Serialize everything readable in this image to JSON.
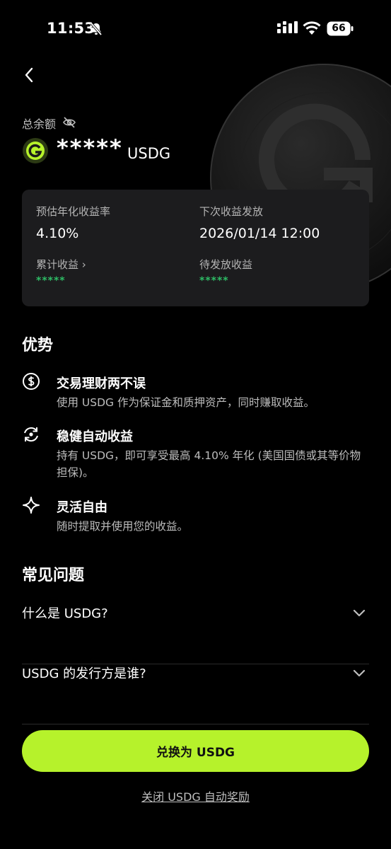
{
  "status_bar": {
    "time": "11:53",
    "battery": "66"
  },
  "balance": {
    "label": "总余额",
    "value": "*****",
    "currency": "USDG"
  },
  "card": {
    "apy_label": "预估年化收益率",
    "apy_value": "4.10%",
    "next_label": "下次收益发放",
    "next_value": "2026/01/14 12:00",
    "cumulative_label": "累计收益 ›",
    "cumulative_value": "*****",
    "pending_label": "待发放收益",
    "pending_value": "*****"
  },
  "advantages": {
    "title": "优势",
    "items": [
      {
        "icon": "dollar-circle-icon",
        "title": "交易理财两不误",
        "desc": "使用 USDG 作为保证金和质押资产，同时赚取收益。"
      },
      {
        "icon": "refresh-eye-icon",
        "title": "稳健自动收益",
        "desc": "持有 USDG，即可享受最高 4.10% 年化 (美国国债或其等价物担保)。"
      },
      {
        "icon": "sparkle-icon",
        "title": "灵活自由",
        "desc": "随时提取并使用您的收益。"
      }
    ]
  },
  "faq": {
    "title": "常见问题",
    "items": [
      {
        "question": "什么是 USDG?"
      },
      {
        "question": "USDG 的发行方是谁?"
      }
    ]
  },
  "cta_label": "兑换为 USDG",
  "link_label": "关闭 USDG 自动奖励",
  "colors": {
    "accent": "#b6f22b",
    "green": "#2ebd66",
    "card": "#1c1c1e"
  }
}
